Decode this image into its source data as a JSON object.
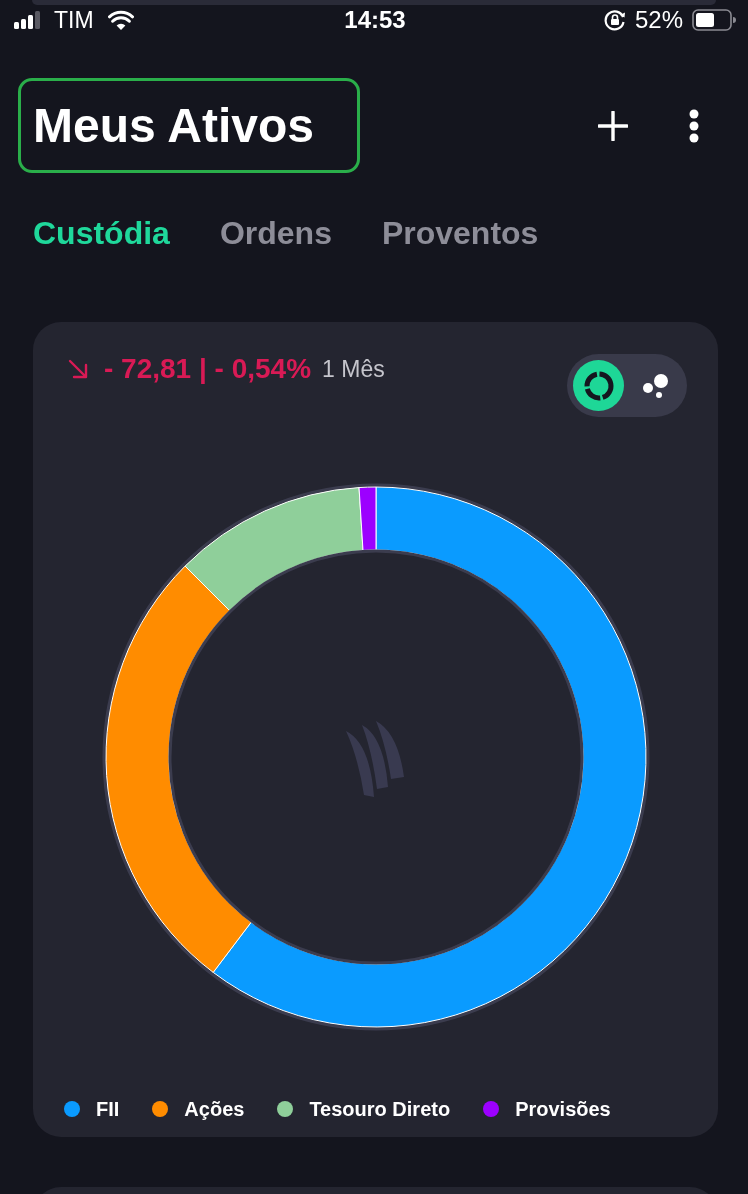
{
  "status_bar": {
    "carrier": "TIM",
    "time": "14:53",
    "battery": "52%"
  },
  "header": {
    "title": "Meus Ativos",
    "highlighted": true
  },
  "tabs": [
    {
      "label": "Custódia",
      "selected": true
    },
    {
      "label": "Ordens",
      "selected": false
    },
    {
      "label": "Proventos",
      "selected": false
    }
  ],
  "performance": {
    "negative": true,
    "change": "- 72,81 | - 0,54%",
    "period": "1 Mês"
  },
  "chart_view_toggle": [
    {
      "kind": "donut",
      "selected": true
    },
    {
      "kind": "bubbles",
      "selected": false
    }
  ],
  "legend": [
    {
      "label": "FII",
      "color": "#0a9bff"
    },
    {
      "label": "Ações",
      "color": "#ff8c00"
    },
    {
      "label": "Tesouro Direto",
      "color": "#8fcf9a"
    },
    {
      "label": "Provisões",
      "color": "#9c00ff"
    }
  ]
}
